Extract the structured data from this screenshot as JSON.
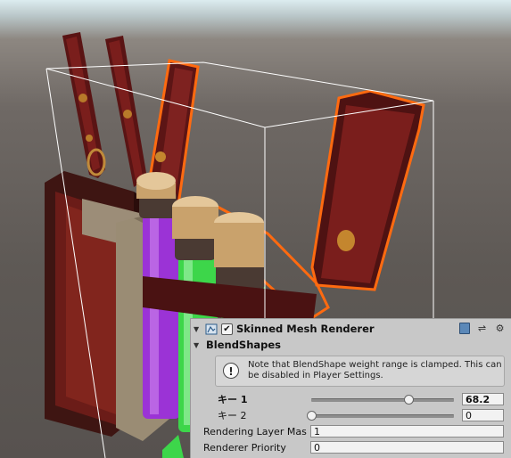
{
  "component": {
    "title": "Skinned Mesh Renderer",
    "enabled": true
  },
  "blendshapes": {
    "section_label": "BlendShapes",
    "help_text": "Note that BlendShape weight range is clamped. This can be disabled in Player Settings.",
    "items": [
      {
        "label": "キー 1",
        "value": "68.2",
        "weight": 0.682,
        "bold": true
      },
      {
        "label": "キー 2",
        "value": "0",
        "weight": 0.0,
        "bold": false
      }
    ]
  },
  "properties": {
    "rendering_layer_mask_label": "Rendering Layer Mas",
    "rendering_layer_mask_value": "1",
    "renderer_priority_label": "Renderer Priority",
    "renderer_priority_value": "0"
  },
  "icons": {
    "foldout": "triangle-down-icon",
    "component": "skinned-mesh-renderer-icon",
    "header_actions": [
      "help-book-icon",
      "preset-icon",
      "gear-icon"
    ],
    "help": "info-icon"
  },
  "colors": {
    "selection_outline": "#ff6a10",
    "bounds_box": "#ffffff",
    "potion_purple": "#9b33d6",
    "potion_green": "#3dd64a",
    "strap_red": "#6e1a1a",
    "panel_bg": "#c8c8c8"
  }
}
